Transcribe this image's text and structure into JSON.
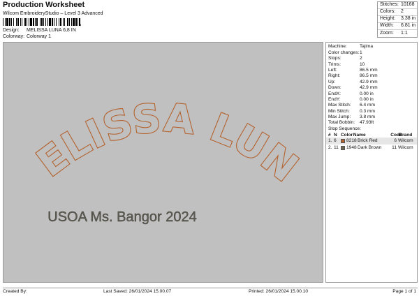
{
  "header": {
    "title": "Production Worksheet",
    "subtitle": "Wilcom EmbroideryStudio – Level 3 Advanced",
    "barcode_suffix": ","
  },
  "meta": [
    {
      "label": "Design:",
      "value": "MELISSA LUNA 6,8 IN"
    },
    {
      "label": "Colorway:",
      "value": "Colorway 1"
    }
  ],
  "summary": [
    {
      "label": "Stitches:",
      "value": "10168"
    },
    {
      "label": "Colors:",
      "value": "2"
    },
    {
      "label": "Height:",
      "value": "3.38 in"
    },
    {
      "label": "Width:",
      "value": "6.81 in"
    },
    {
      "label": "Zoom:",
      "value": "1:1"
    }
  ],
  "design": {
    "arc_text": "MELISSA LUNA",
    "sub_text": "USOA  Ms. Bangor  2024",
    "colors": {
      "background": "#c0c0c0",
      "outline": "#b4622e",
      "fill": "#c0c0c0",
      "sub_text": "#5e5d54"
    }
  },
  "info": [
    {
      "label": "Machine:",
      "value": "Tajima"
    },
    {
      "label": "Color changes:",
      "value": "1"
    },
    {
      "label": "Stops:",
      "value": "2"
    },
    {
      "label": "Trims:",
      "value": "10"
    },
    {
      "label": "Left:",
      "value": "86.5 mm"
    },
    {
      "label": "Right:",
      "value": "86.5 mm"
    },
    {
      "label": "Up:",
      "value": "42.9 mm"
    },
    {
      "label": "Down:",
      "value": "42.9 mm"
    },
    {
      "label": "EndX:",
      "value": "0.00 in"
    },
    {
      "label": "EndY:",
      "value": "0.00 in"
    },
    {
      "label": "Max Stitch:",
      "value": "6.4 mm"
    },
    {
      "label": "Min Stitch:",
      "value": "0.3 mm"
    },
    {
      "label": "Max Jump:",
      "value": "3.8 mm"
    },
    {
      "label": "Total Bobbin:",
      "value": "47.93ft"
    }
  ],
  "stop_sequence": {
    "title": "Stop Sequence:",
    "headers": [
      "#",
      "N",
      "Color",
      "Name",
      "Code",
      "Brand"
    ],
    "rows": [
      {
        "num": "1.",
        "n": "6",
        "swatch": "#b4622e",
        "color": "8218",
        "name": "Brick Red",
        "code": "6",
        "brand": "Wilcom"
      },
      {
        "num": "2.",
        "n": "11",
        "swatch": "#6b6353",
        "color": "1948",
        "name": "Dark Brown",
        "code": "11",
        "brand": "Wilcom"
      }
    ]
  },
  "footer": {
    "created_by": "Created By:",
    "last_saved": "Last Saved: 26/01/2024 15.00.07",
    "printed": "Printed: 26/01/2024 15.00.10",
    "page": "Page 1 of 1"
  }
}
